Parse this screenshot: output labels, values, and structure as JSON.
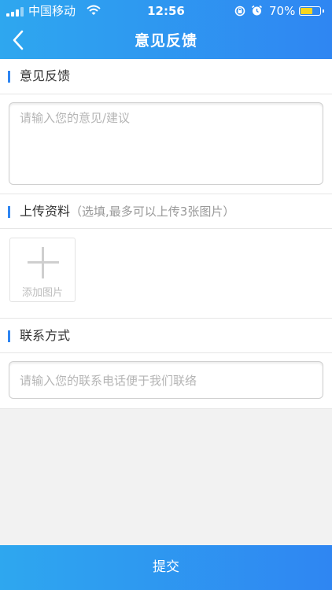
{
  "status_bar": {
    "carrier": "中国移动",
    "time": "12:56",
    "battery_percent": "70%",
    "battery_level": 0.7,
    "battery_color": "#f7d41f"
  },
  "nav": {
    "title": "意见反馈",
    "back_icon": "chevron-left-icon"
  },
  "feedback": {
    "section_title": "意见反馈",
    "placeholder": "请输入您的意见/建议"
  },
  "upload": {
    "section_title": "上传资料",
    "hint": "（选填,最多可以上传3张图片）",
    "add_label": "添加图片",
    "add_icon": "plus-icon"
  },
  "contact": {
    "section_title": "联系方式",
    "placeholder": "请输入您的联系电话便于我们联络"
  },
  "submit_label": "提交",
  "colors": {
    "accent": "#2f86f2",
    "accent_light": "#2ea7ef",
    "background": "#f2f2f2"
  }
}
